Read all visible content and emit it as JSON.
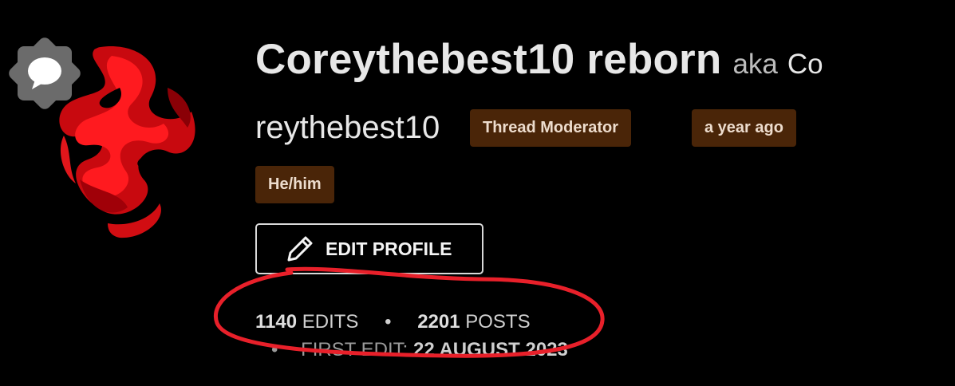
{
  "profile": {
    "username": "Coreythebest10 reborn",
    "aka_label": "aka",
    "aka_name_part1": "Co",
    "aka_name_part2": "reythebest10",
    "badges": {
      "role": "Thread Moderator",
      "joined": "a year ago",
      "pronouns": "He/him"
    },
    "edit_button_label": "EDIT PROFILE",
    "stats": {
      "edits_count": "1140",
      "edits_label": "EDITS",
      "separator": "•",
      "posts_count": "2201",
      "posts_label": "POSTS"
    },
    "first_edit": {
      "bullet": "•",
      "label": "FIRST EDIT:",
      "date": "22 AUGUST 2023"
    }
  },
  "icons": {
    "online_badge": "chat-bubble-icon",
    "edit": "pencil-icon"
  },
  "colors": {
    "background": "#000000",
    "badge_bg": "#4a2508",
    "badge_text": "#eddccd",
    "annotation": "#e8202a"
  }
}
